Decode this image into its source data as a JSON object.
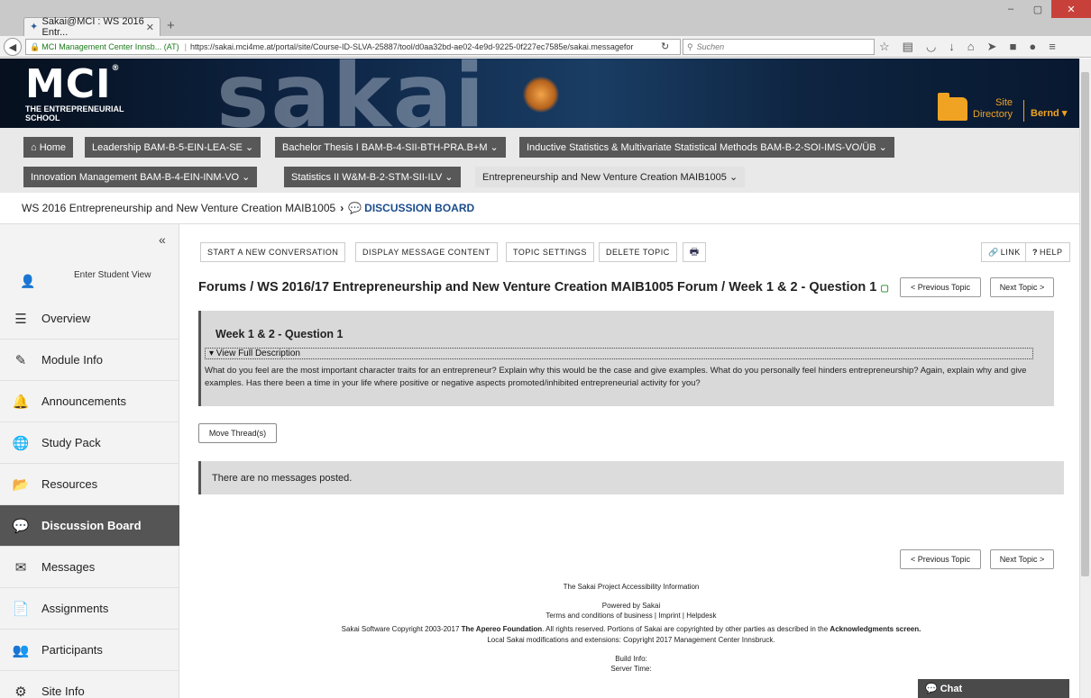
{
  "browser": {
    "tab_title": "Sakai@MCI : WS 2016 Entr...",
    "tab_close": "✕",
    "new_tab": "+",
    "url_site": "MCI Management Center Innsb... (AT)",
    "url": "https://sakai.mci4me.at/portal/site/Course-ID-SLVA-25887/tool/d0aa32bd-ae02-4e9d-9225-0f227ec7585e/sakai.messagefor",
    "search_placeholder": "Suchen",
    "window_buttons": [
      "–",
      "▢",
      "✕"
    ]
  },
  "header": {
    "logo": "MCI",
    "logo_tag_1": "THE ENTREPRENEURIAL",
    "logo_tag_2": "SCHOOL",
    "sakai_word": "sakai",
    "site_directory_1": "Site",
    "site_directory_2": "Directory",
    "user": "Bernd ▾"
  },
  "site_tabs": [
    {
      "label": "⌂ Home"
    },
    {
      "label": "Leadership BAM-B-5-EIN-LEA-SE ⌄"
    },
    {
      "label": "Bachelor Thesis I BAM-B-4-SII-BTH-PRA.B+M ⌄"
    },
    {
      "label": "Inductive Statistics & Multivariate Statistical Methods BAM-B-2-SOI-IMS-VO/ÜB ⌄"
    },
    {
      "label": "Innovation Management BAM-B-4-EIN-INM-VO ⌄"
    },
    {
      "label": "Statistics II W&M-B-2-STM-SII-ILV ⌄"
    },
    {
      "label": "Entrepreneurship and New Venture Creation MAIB1005 ⌄"
    }
  ],
  "breadcrumb": {
    "site": "WS 2016 Entrepreneurship and New Venture Creation MAIB1005",
    "separator": "›",
    "tool": "DISCUSSION BOARD"
  },
  "tool_menu": {
    "collapse": "«",
    "student_view": "Enter Student View",
    "items": [
      {
        "label": "Overview"
      },
      {
        "label": "Module Info"
      },
      {
        "label": "Announcements"
      },
      {
        "label": "Study Pack"
      },
      {
        "label": "Resources"
      },
      {
        "label": "Discussion Board"
      },
      {
        "label": "Messages"
      },
      {
        "label": "Assignments"
      },
      {
        "label": "Participants"
      },
      {
        "label": "Site Info"
      }
    ]
  },
  "toolbar": {
    "start": "START A NEW CONVERSATION",
    "display": "DISPLAY MESSAGE CONTENT",
    "settings": "TOPIC SETTINGS",
    "delete": "DELETE TOPIC",
    "link": "LINK",
    "help": "HELP"
  },
  "page": {
    "title": "Forums / WS 2016/17 Entrepreneurship and New Venture Creation MAIB1005 Forum / Week 1 & 2 - Question 1",
    "prev_topic": "< Previous Topic",
    "next_topic": "Next Topic >",
    "topic_name": "Week 1 & 2 - Question 1",
    "view_full": "▾ View Full Description",
    "description": "What do you feel are the most important character traits for an entrepreneur? Explain why this would be the case and give examples. What do you personally feel hinders entrepreneurship? Again, explain why and give examples. Has there been a time in your life where positive or negative aspects promoted/inhibited entrepreneurial activity for you?",
    "move_threads": "Move Thread(s)",
    "no_messages": "There are no messages posted."
  },
  "footer": {
    "accessibility": "The Sakai Project Accessibility Information",
    "powered": "Powered by Sakai",
    "terms": "Terms and conditions of business | Imprint | Helpdesk",
    "copyright_a": "Sakai Software Copyright 2003-2017",
    "copyright_b": "The Apereo Foundation",
    "copyright_c": ". All rights reserved. Portions of Sakai are copyrighted by other parties as described in the",
    "copyright_d": "Acknowledgments screen.",
    "local": "Local Sakai modifications and extensions: Copyright 2017 Management Center Innsbruck.",
    "build": "Build Info:",
    "server_time": "Server Time:"
  },
  "chat": {
    "label": "Chat"
  },
  "colors": {
    "accent_orange": "#f0a322",
    "tab_dark": "#585858",
    "menu_active": "#555555"
  }
}
